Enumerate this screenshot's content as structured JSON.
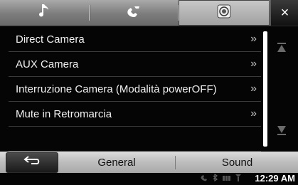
{
  "tabs": [
    {
      "icon": "music-note-icon",
      "label": ""
    },
    {
      "icon": "phone-icon",
      "label": ""
    },
    {
      "icon": "camera-lens-icon",
      "label": ""
    }
  ],
  "close_label": "×",
  "menu_items": [
    {
      "label": "Direct Camera",
      "arrow": "»"
    },
    {
      "label": "AUX Camera",
      "arrow": "»"
    },
    {
      "label": "Interruzione Camera (Modalità powerOFF)",
      "arrow": "»"
    },
    {
      "label": "Mute in Retromarcia",
      "arrow": "»"
    }
  ],
  "bottom": {
    "general_label": "General",
    "sound_label": "Sound"
  },
  "status": {
    "time": "12:29 AM"
  },
  "colors": {
    "topbar": "#8a8a8a",
    "background": "#050505",
    "bottombar": "#c4c4c4"
  }
}
